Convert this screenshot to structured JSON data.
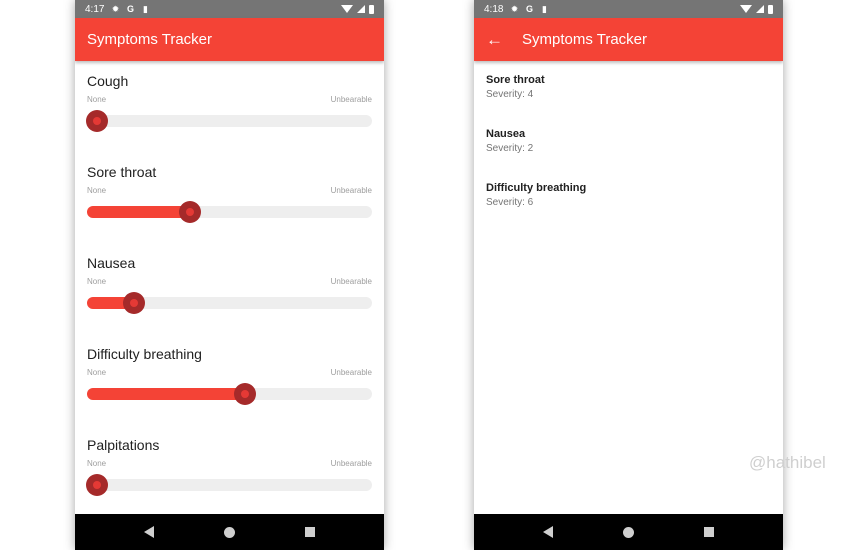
{
  "theme": {
    "primary": "#f44336",
    "thumb_outer": "#a52a2a",
    "thumb_inner": "#e53935",
    "track": "#eeeeee"
  },
  "left_screen": {
    "status": {
      "time": "4:17",
      "icons": [
        "settings-icon",
        "google-icon",
        "sd-card-icon"
      ],
      "right_icons": [
        "wifi-icon",
        "signal-icon",
        "battery-icon"
      ]
    },
    "appbar": {
      "title": "Symptoms Tracker"
    },
    "symptoms": [
      {
        "name": "Cough",
        "min_label": "None",
        "max_label": "Unbearable",
        "value_fraction": 0.0
      },
      {
        "name": "Sore throat",
        "min_label": "None",
        "max_label": "Unbearable",
        "value_fraction": 0.35
      },
      {
        "name": "Nausea",
        "min_label": "None",
        "max_label": "Unbearable",
        "value_fraction": 0.14
      },
      {
        "name": "Difficulty breathing",
        "min_label": "None",
        "max_label": "Unbearable",
        "value_fraction": 0.56
      },
      {
        "name": "Palpitations",
        "min_label": "None",
        "max_label": "Unbearable",
        "value_fraction": 0.0
      }
    ]
  },
  "right_screen": {
    "status": {
      "time": "4:18",
      "icons": [
        "settings-icon",
        "google-icon",
        "sd-card-icon"
      ],
      "right_icons": [
        "wifi-icon",
        "signal-icon",
        "battery-icon"
      ]
    },
    "appbar": {
      "title": "Symptoms Tracker",
      "back_icon": "arrow-back-icon"
    },
    "items": [
      {
        "title": "Sore throat",
        "subtitle": "Severity: 4"
      },
      {
        "title": "Nausea",
        "subtitle": "Severity: 2"
      },
      {
        "title": "Difficulty breathing",
        "subtitle": "Severity: 6"
      }
    ]
  },
  "watermark": "@hathibel"
}
